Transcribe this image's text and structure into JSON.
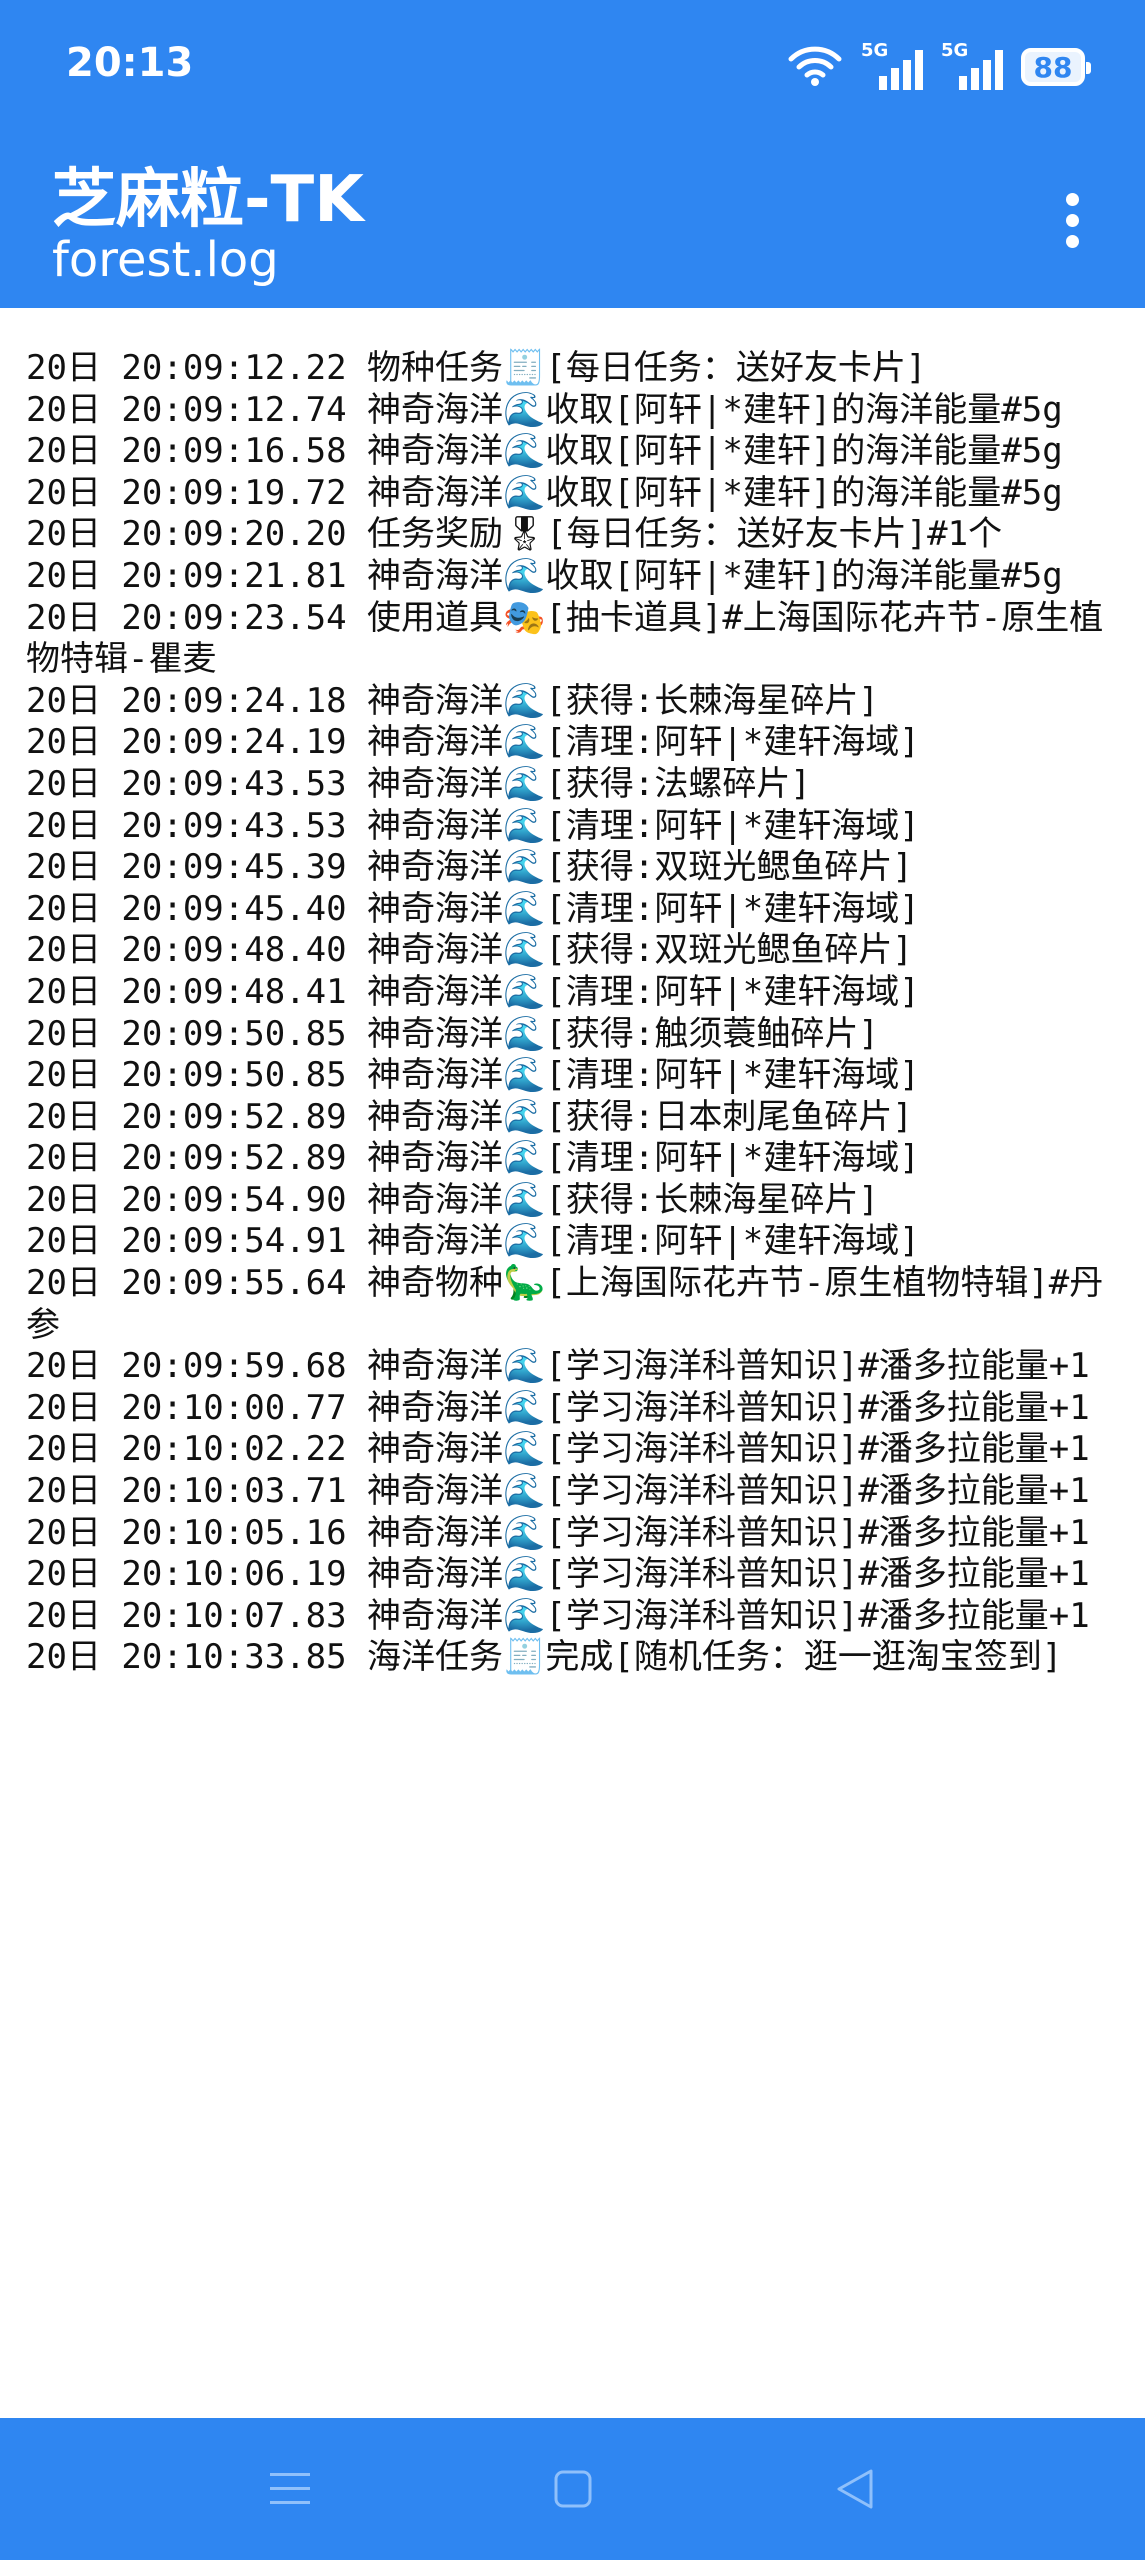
{
  "status_bar": {
    "time": "20:13",
    "network1": "5G",
    "network2": "5G",
    "battery": "88",
    "icons": [
      "wifi-icon",
      "signal-icon",
      "signal-icon",
      "battery-icon"
    ]
  },
  "app_bar": {
    "title": "芝麻粒-TK",
    "subtitle": "forest.log",
    "menu_icon": "more-vert-icon"
  },
  "log_lines": [
    "20日 20:09:12.22 物种任务🧾[每日任务：送好友卡片]",
    "20日 20:09:12.74 神奇海洋🌊收取[阿轩|*建轩]的海洋能量#5g",
    "20日 20:09:16.58 神奇海洋🌊收取[阿轩|*建轩]的海洋能量#5g",
    "20日 20:09:19.72 神奇海洋🌊收取[阿轩|*建轩]的海洋能量#5g",
    "20日 20:09:20.20 任务奖励🎖[每日任务：送好友卡片]#1个",
    "20日 20:09:21.81 神奇海洋🌊收取[阿轩|*建轩]的海洋能量#5g",
    "20日 20:09:23.54 使用道具🎭[抽卡道具]#上海国际花卉节-原生植物特辑-瞿麦",
    "20日 20:09:24.18 神奇海洋🌊[获得:长棘海星碎片]",
    "20日 20:09:24.19 神奇海洋🌊[清理:阿轩|*建轩海域]",
    "20日 20:09:43.53 神奇海洋🌊[获得:法螺碎片]",
    "20日 20:09:43.53 神奇海洋🌊[清理:阿轩|*建轩海域]",
    "20日 20:09:45.39 神奇海洋🌊[获得:双斑光鳃鱼碎片]",
    "20日 20:09:45.40 神奇海洋🌊[清理:阿轩|*建轩海域]",
    "20日 20:09:48.40 神奇海洋🌊[获得:双斑光鳃鱼碎片]",
    "20日 20:09:48.41 神奇海洋🌊[清理:阿轩|*建轩海域]",
    "20日 20:09:50.85 神奇海洋🌊[获得:触须蓑鲉碎片]",
    "20日 20:09:50.85 神奇海洋🌊[清理:阿轩|*建轩海域]",
    "20日 20:09:52.89 神奇海洋🌊[获得:日本刺尾鱼碎片]",
    "20日 20:09:52.89 神奇海洋🌊[清理:阿轩|*建轩海域]",
    "20日 20:09:54.90 神奇海洋🌊[获得:长棘海星碎片]",
    "20日 20:09:54.91 神奇海洋🌊[清理:阿轩|*建轩海域]",
    "20日 20:09:55.64 神奇物种🦕[上海国际花卉节-原生植物特辑]#丹参",
    "20日 20:09:59.68 神奇海洋🌊[学习海洋科普知识]#潘多拉能量+1",
    "20日 20:10:00.77 神奇海洋🌊[学习海洋科普知识]#潘多拉能量+1",
    "20日 20:10:02.22 神奇海洋🌊[学习海洋科普知识]#潘多拉能量+1",
    "20日 20:10:03.71 神奇海洋🌊[学习海洋科普知识]#潘多拉能量+1",
    "20日 20:10:05.16 神奇海洋🌊[学习海洋科普知识]#潘多拉能量+1",
    "20日 20:10:06.19 神奇海洋🌊[学习海洋科普知识]#潘多拉能量+1",
    "20日 20:10:07.83 神奇海洋🌊[学习海洋科普知识]#潘多拉能量+1",
    "20日 20:10:33.85 海洋任务🧾完成[随机任务：逛一逛淘宝签到]"
  ],
  "nav_bar": {
    "buttons": [
      "menu-icon",
      "home-icon",
      "back-icon"
    ]
  },
  "colors": {
    "primary": "#2f86f1",
    "on_primary": "#ffffff",
    "text": "#111111",
    "background": "#ffffff"
  }
}
